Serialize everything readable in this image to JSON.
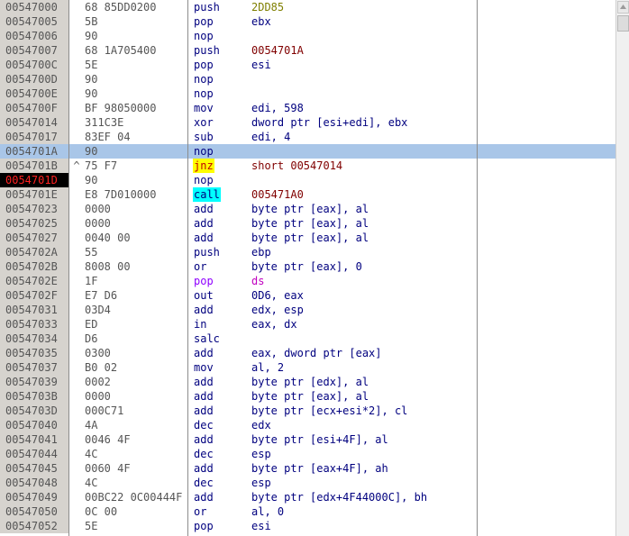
{
  "colors": {
    "mnemonic_default": "#00007f",
    "mnemonic_jump": "#c00000",
    "mnemonic_segment": "#8f00ff",
    "operand_default": "#00007f",
    "operand_immediate": "#7f7f00",
    "operand_target": "#800000",
    "operand_segment": "#c000c0",
    "selection": "#a9c6e8",
    "breakpoint_bg": "#000000",
    "breakpoint_fg": "#ff2020"
  },
  "rows": [
    {
      "addr": "00547000",
      "mark": "",
      "hex": "68 85DD0200",
      "mnem": "push",
      "mnem_color": "#00007f",
      "ops": "2DD85",
      "ops_color": "#7f7f00"
    },
    {
      "addr": "00547005",
      "mark": "",
      "hex": "5B",
      "mnem": "pop",
      "mnem_color": "#00007f",
      "ops": "ebx",
      "ops_color": "#00007f"
    },
    {
      "addr": "00547006",
      "mark": "",
      "hex": "90",
      "mnem": "nop",
      "mnem_color": "#00007f",
      "ops": "",
      "ops_color": "#00007f"
    },
    {
      "addr": "00547007",
      "mark": "",
      "hex": "68 1A705400",
      "mnem": "push",
      "mnem_color": "#00007f",
      "ops": "0054701A",
      "ops_color": "#800000"
    },
    {
      "addr": "0054700C",
      "mark": "",
      "hex": "5E",
      "mnem": "pop",
      "mnem_color": "#00007f",
      "ops": "esi",
      "ops_color": "#00007f"
    },
    {
      "addr": "0054700D",
      "mark": "",
      "hex": "90",
      "mnem": "nop",
      "mnem_color": "#00007f",
      "ops": "",
      "ops_color": "#00007f"
    },
    {
      "addr": "0054700E",
      "mark": "",
      "hex": "90",
      "mnem": "nop",
      "mnem_color": "#00007f",
      "ops": "",
      "ops_color": "#00007f"
    },
    {
      "addr": "0054700F",
      "mark": "",
      "hex": "BF 98050000",
      "mnem": "mov",
      "mnem_color": "#00007f",
      "ops": "edi, 598",
      "ops_color": "#00007f"
    },
    {
      "addr": "00547014",
      "mark": "",
      "hex": "311C3E",
      "mnem": "xor",
      "mnem_color": "#00007f",
      "ops": "dword ptr [esi+edi], ebx",
      "ops_color": "#00007f"
    },
    {
      "addr": "00547017",
      "mark": "",
      "hex": "83EF 04",
      "mnem": "sub",
      "mnem_color": "#00007f",
      "ops": "edi, 4",
      "ops_color": "#00007f"
    },
    {
      "addr": "0054701A",
      "mark": "",
      "hex": "90",
      "mnem": "nop",
      "mnem_color": "#00007f",
      "ops": "",
      "ops_color": "#00007f",
      "selected": true
    },
    {
      "addr": "0054701B",
      "mark": "^",
      "hex": "75 F7",
      "mnem": "jnz",
      "mnem_color": "#c00000",
      "mnem_hl": "yellow",
      "ops": "short 00547014",
      "ops_color": "#800000"
    },
    {
      "addr": "0054701D",
      "mark": "",
      "hex": "90",
      "mnem": "nop",
      "mnem_color": "#00007f",
      "ops": "",
      "ops_color": "#00007f",
      "breakpoint": true
    },
    {
      "addr": "0054701E",
      "mark": "",
      "hex": "E8 7D010000",
      "mnem": "call",
      "mnem_color": "#00007f",
      "mnem_hl": "cyan",
      "ops": "005471A0",
      "ops_color": "#800000"
    },
    {
      "addr": "00547023",
      "mark": "",
      "hex": "0000",
      "mnem": "add",
      "mnem_color": "#00007f",
      "ops": "byte ptr [eax], al",
      "ops_color": "#00007f"
    },
    {
      "addr": "00547025",
      "mark": "",
      "hex": "0000",
      "mnem": "add",
      "mnem_color": "#00007f",
      "ops": "byte ptr [eax], al",
      "ops_color": "#00007f"
    },
    {
      "addr": "00547027",
      "mark": "",
      "hex": "0040 00",
      "mnem": "add",
      "mnem_color": "#00007f",
      "ops": "byte ptr [eax], al",
      "ops_color": "#00007f"
    },
    {
      "addr": "0054702A",
      "mark": "",
      "hex": "55",
      "mnem": "push",
      "mnem_color": "#00007f",
      "ops": "ebp",
      "ops_color": "#00007f"
    },
    {
      "addr": "0054702B",
      "mark": "",
      "hex": "8008 00",
      "mnem": "or",
      "mnem_color": "#00007f",
      "ops": "byte ptr [eax], 0",
      "ops_color": "#00007f"
    },
    {
      "addr": "0054702E",
      "mark": "",
      "hex": "1F",
      "mnem": "pop",
      "mnem_color": "#8f00ff",
      "ops": "ds",
      "ops_color": "#c000c0"
    },
    {
      "addr": "0054702F",
      "mark": "",
      "hex": "E7 D6",
      "mnem": "out",
      "mnem_color": "#00007f",
      "ops": "0D6, eax",
      "ops_color": "#00007f"
    },
    {
      "addr": "00547031",
      "mark": "",
      "hex": "03D4",
      "mnem": "add",
      "mnem_color": "#00007f",
      "ops": "edx, esp",
      "ops_color": "#00007f"
    },
    {
      "addr": "00547033",
      "mark": "",
      "hex": "ED",
      "mnem": "in",
      "mnem_color": "#00007f",
      "ops": "eax, dx",
      "ops_color": "#00007f"
    },
    {
      "addr": "00547034",
      "mark": "",
      "hex": "D6",
      "mnem": "salc",
      "mnem_color": "#00007f",
      "ops": "",
      "ops_color": "#00007f"
    },
    {
      "addr": "00547035",
      "mark": "",
      "hex": "0300",
      "mnem": "add",
      "mnem_color": "#00007f",
      "ops": "eax, dword ptr [eax]",
      "ops_color": "#00007f"
    },
    {
      "addr": "00547037",
      "mark": "",
      "hex": "B0 02",
      "mnem": "mov",
      "mnem_color": "#00007f",
      "ops": "al, 2",
      "ops_color": "#00007f"
    },
    {
      "addr": "00547039",
      "mark": "",
      "hex": "0002",
      "mnem": "add",
      "mnem_color": "#00007f",
      "ops": "byte ptr [edx], al",
      "ops_color": "#00007f"
    },
    {
      "addr": "0054703B",
      "mark": "",
      "hex": "0000",
      "mnem": "add",
      "mnem_color": "#00007f",
      "ops": "byte ptr [eax], al",
      "ops_color": "#00007f"
    },
    {
      "addr": "0054703D",
      "mark": "",
      "hex": "000C71",
      "mnem": "add",
      "mnem_color": "#00007f",
      "ops": "byte ptr [ecx+esi*2], cl",
      "ops_color": "#00007f"
    },
    {
      "addr": "00547040",
      "mark": "",
      "hex": "4A",
      "mnem": "dec",
      "mnem_color": "#00007f",
      "ops": "edx",
      "ops_color": "#00007f"
    },
    {
      "addr": "00547041",
      "mark": "",
      "hex": "0046 4F",
      "mnem": "add",
      "mnem_color": "#00007f",
      "ops": "byte ptr [esi+4F], al",
      "ops_color": "#00007f"
    },
    {
      "addr": "00547044",
      "mark": "",
      "hex": "4C",
      "mnem": "dec",
      "mnem_color": "#00007f",
      "ops": "esp",
      "ops_color": "#00007f"
    },
    {
      "addr": "00547045",
      "mark": "",
      "hex": "0060 4F",
      "mnem": "add",
      "mnem_color": "#00007f",
      "ops": "byte ptr [eax+4F], ah",
      "ops_color": "#00007f"
    },
    {
      "addr": "00547048",
      "mark": "",
      "hex": "4C",
      "mnem": "dec",
      "mnem_color": "#00007f",
      "ops": "esp",
      "ops_color": "#00007f"
    },
    {
      "addr": "00547049",
      "mark": "",
      "hex": "00BC22 0C00444F",
      "mnem": "add",
      "mnem_color": "#00007f",
      "ops": "byte ptr [edx+4F44000C], bh",
      "ops_color": "#00007f"
    },
    {
      "addr": "00547050",
      "mark": "",
      "hex": "0C 00",
      "mnem": "or",
      "mnem_color": "#00007f",
      "ops": "al, 0",
      "ops_color": "#00007f"
    },
    {
      "addr": "00547052",
      "mark": "",
      "hex": "5E",
      "mnem": "pop",
      "mnem_color": "#00007f",
      "ops": "esi",
      "ops_color": "#00007f"
    }
  ],
  "scrollbar": {
    "up_icon": "triangle-up",
    "thumb_position": 0.0
  }
}
